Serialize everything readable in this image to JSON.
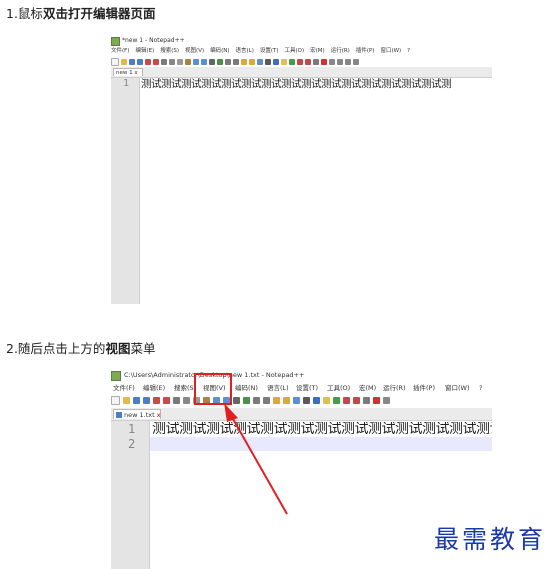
{
  "step1": {
    "prefix": "1.鼠标",
    "bold": "双击打开编辑器页面",
    "suffix": ""
  },
  "step2": {
    "prefix": "2.随后点击上方的",
    "bold": "视图",
    "suffix": "菜单"
  },
  "screenshot1": {
    "window_title": "*new 1 - Notepad++",
    "menu": [
      "文件(F)",
      "编辑(E)",
      "搜索(S)",
      "视图(V)",
      "编码(N)",
      "语言(L)",
      "设置(T)",
      "工具(O)",
      "宏(M)",
      "运行(R)",
      "插件(P)",
      "窗口(W)",
      "?"
    ],
    "tab_label": "new 1",
    "tab_close": "x",
    "line_number": "1",
    "line_text": "测试测试测试测试测试测试测试测试测试测试测试测试测试测试测试测"
  },
  "screenshot2": {
    "window_title": "C:\\Users\\Administrator\\Desktop\\new 1.txt - Notepad++",
    "menu": [
      "文件(F)",
      "编辑(E)",
      "搜索(S)",
      "视图(V)",
      "编码(N)",
      "语言(L)",
      "设置(T)",
      "工具(O)",
      "宏(M)",
      "运行(R)",
      "插件(P)",
      "窗口(W)",
      "?"
    ],
    "tab_label": "new 1.txt",
    "tab_close": "x",
    "line_numbers": [
      "1",
      "2"
    ],
    "line_text": "测试测试测试测试测试测试测试测试测试测试测试测试测试测试测试测"
  },
  "watermark": "最需教育",
  "colors": {
    "highlight": "#e02020",
    "watermark": "#1a3aa8"
  }
}
